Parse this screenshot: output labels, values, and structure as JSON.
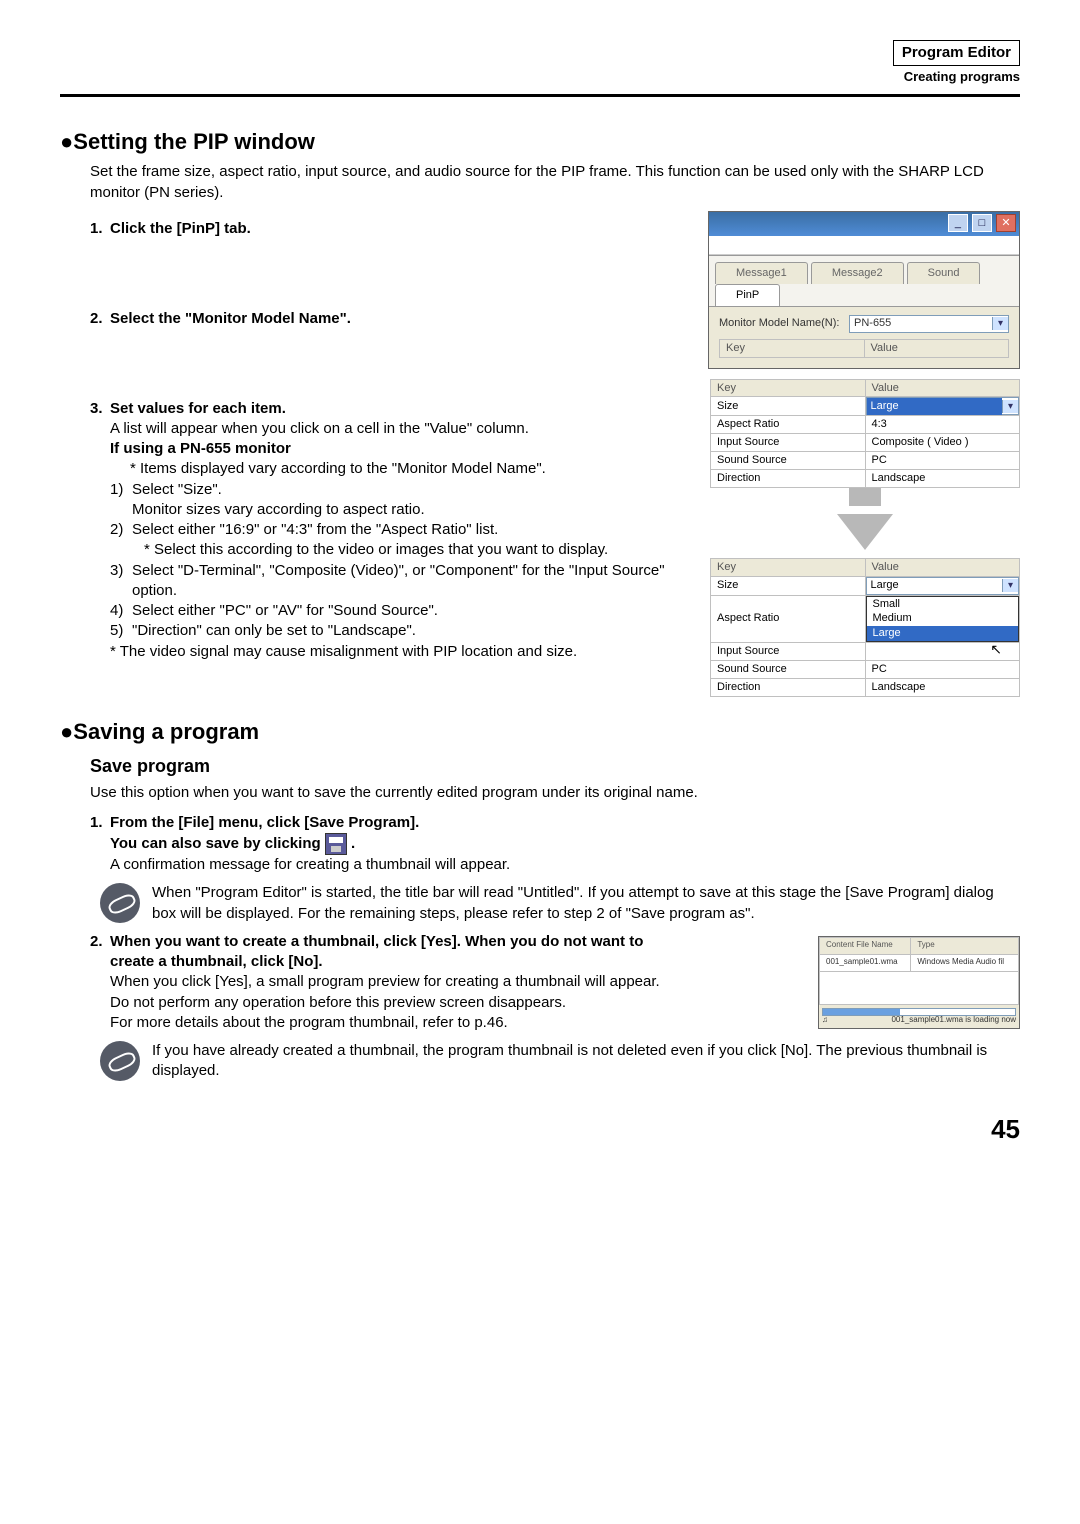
{
  "header": {
    "box": "Program Editor",
    "sub": "Creating programs"
  },
  "section1": {
    "title": "●Setting the PIP window",
    "intro": "Set the frame size, aspect ratio, input source, and audio source for the PIP frame. This function can be used only with the SHARP LCD monitor (PN series).",
    "step1": "Click the [PinP] tab.",
    "step2": "Select the \"Monitor Model Name\".",
    "step3": "Set values for each item.",
    "step3_desc": "A list will appear when you click on a cell in the \"Value\" column.",
    "step3_sub": "If using a PN-655 monitor",
    "note1": "* Items displayed vary according to the \"Monitor Model Name\".",
    "li1a": "Select \"Size\".",
    "li1b": "Monitor sizes vary according to aspect ratio.",
    "li2a": "Select either \"16:9\" or \"4:3\" from the \"Aspect Ratio\" list.",
    "li2b": "* Select this according to the video or images that you want to display.",
    "li3": "Select \"D-Terminal\", \"Composite (Video)\", or \"Component\" for the \"Input Source\" option.",
    "li4": "Select either \"PC\" or \"AV\" for \"Sound Source\".",
    "li5": "\"Direction\" can only be set to \"Landscape\".",
    "note2": "* The video signal may cause misalignment with PIP location and size."
  },
  "fig1": {
    "tabs": {
      "t1": "Message1",
      "t2": "Message2",
      "t3": "Sound",
      "t4": "PinP"
    },
    "mm_label": "Monitor Model Name(N):",
    "mm_value": "PN-655",
    "key": "Key",
    "value": "Value"
  },
  "fig2": {
    "key": "Key",
    "value": "Value",
    "r1k": "Size",
    "r1v": "Large",
    "r2k": "Aspect Ratio",
    "r2v": "4:3",
    "r3k": "Input Source",
    "r3v": "Composite ( Video )",
    "r4k": "Sound Source",
    "r4v": "PC",
    "r5k": "Direction",
    "r5v": "Landscape"
  },
  "fig3": {
    "key": "Key",
    "value": "Value",
    "r1k": "Size",
    "r1v": "Large",
    "r2k": "Aspect Ratio",
    "r3k": "Input Source",
    "r4k": "Sound Source",
    "r4v": "PC",
    "r5k": "Direction",
    "r5v": "Landscape",
    "opts": {
      "small": "Small",
      "medium": "Medium",
      "large": "Large"
    }
  },
  "section2": {
    "title": "●Saving a program",
    "subhead": "Save program",
    "intro": "Use this option when you want to save the currently edited program under its original name.",
    "step1a": "From the [File] menu, click [Save Program].",
    "step1b_pre": "You can also save by clicking ",
    "step1b_post": " .",
    "step1_desc": "A confirmation message for creating a thumbnail will appear.",
    "tip1": "When \"Program Editor\" is started, the title bar will read \"Untitled\". If you attempt to save at this stage the [Save Program] dialog box will be displayed. For the remaining steps, please refer to step 2 of \"Save program as\".",
    "step2a": "When you want to create a thumbnail, click [Yes]. When you do not want to create a thumbnail, click [No].",
    "step2_desc1": "When you click [Yes], a small program preview for creating a thumbnail will appear. Do not perform any operation before this preview screen disappears.",
    "step2_desc2": "For more details about the program thumbnail, refer to p.46.",
    "tip2": "If you have already created a thumbnail, the program thumbnail is not deleted even if you click [No]. The previous thumbnail is displayed."
  },
  "fig4": {
    "col1": "Content File Name",
    "col2": "Type",
    "row1a": "001_sample01.wma",
    "row1b": "Windows Media Audio fil",
    "footer": "001_sample01.wma is loading now"
  },
  "page": "45"
}
